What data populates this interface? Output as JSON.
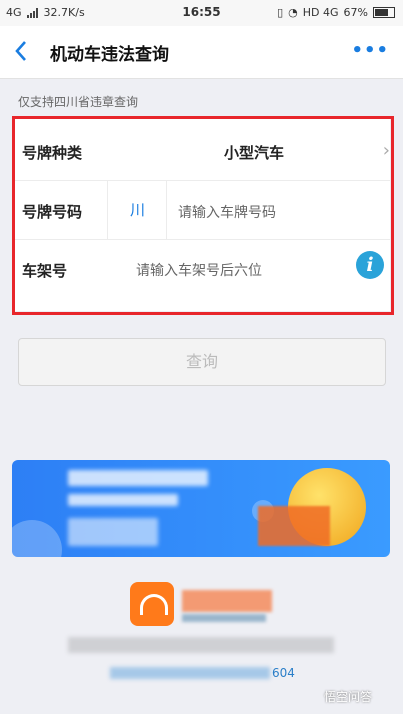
{
  "status": {
    "network": "4G",
    "speed": "32.7K/s",
    "time": "16:55",
    "network_right": "HD 4G",
    "battery": "67%"
  },
  "header": {
    "title": "机动车违法查询",
    "back_icon": "chevron-left-icon",
    "more_icon": "more-dots-icon"
  },
  "note": "仅支持四川省违章查询",
  "form": {
    "plate_type_label": "号牌种类",
    "plate_type_value": "小型汽车",
    "plate_number_label": "号牌号码",
    "province": "川",
    "plate_number_placeholder": "请输入车牌号码",
    "vin_label": "车架号",
    "vin_placeholder": "请输入车架号后六位"
  },
  "query_button": "查询",
  "footer": {
    "phone_suffix": "604",
    "watermark": "悟空问答"
  },
  "colors": {
    "accent": "#1a7de0",
    "highlight_frame": "#e8262b",
    "banner": "#2d7ff5"
  }
}
